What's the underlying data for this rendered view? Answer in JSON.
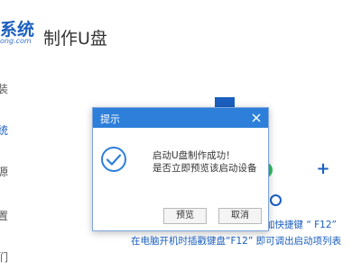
{
  "header": {
    "logo_main": "系统",
    "logo_sub": "ong.com",
    "title": "制作U盘"
  },
  "sidebar": {
    "items": [
      {
        "label": "装",
        "active": false
      },
      {
        "label": "统",
        "active": true
      },
      {
        "label": "源",
        "active": false
      },
      {
        "label": "置",
        "active": false
      },
      {
        "label": "们",
        "active": false
      }
    ]
  },
  "background": {
    "hint_line1": "加快捷键 “ F12”",
    "hint_line2": "在电脑开机时插戳键盘“F12” 即可调出启动项列表"
  },
  "dialog": {
    "title": "提示",
    "message_line1": "启动U盘制作成功！",
    "message_line2": "是否立即预览该启动设备",
    "preview_label": "预览",
    "cancel_label": "取消"
  },
  "colors": {
    "accent": "#2d7fd9",
    "brand": "#1b5fbf",
    "success": "#2fbf5a"
  },
  "icons": {
    "close": "close-icon",
    "success": "check-circle-icon",
    "add": "plus-icon"
  }
}
